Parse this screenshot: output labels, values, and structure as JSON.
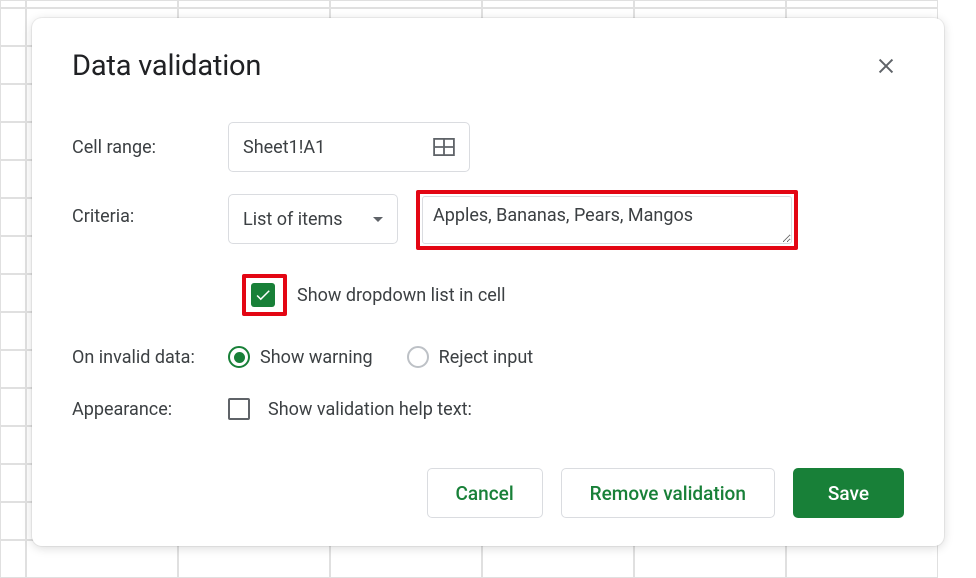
{
  "dialog": {
    "title": "Data validation",
    "labels": {
      "cell_range": "Cell range:",
      "criteria": "Criteria:",
      "on_invalid": "On invalid data:",
      "appearance": "Appearance:"
    },
    "cell_range_value": "Sheet1!A1",
    "criteria_selected": "List of items",
    "items_value": "Apples, Bananas, Pears, Mangos",
    "show_dropdown_label": "Show dropdown list in cell",
    "show_dropdown_checked": true,
    "invalid_options": {
      "show_warning": "Show warning",
      "reject_input": "Reject input"
    },
    "invalid_selected": "show_warning",
    "appearance_option": "Show validation help text:",
    "appearance_checked": false,
    "buttons": {
      "cancel": "Cancel",
      "remove": "Remove validation",
      "save": "Save"
    }
  },
  "annotations": {
    "highlight_checkbox": true,
    "highlight_items_field": true
  }
}
